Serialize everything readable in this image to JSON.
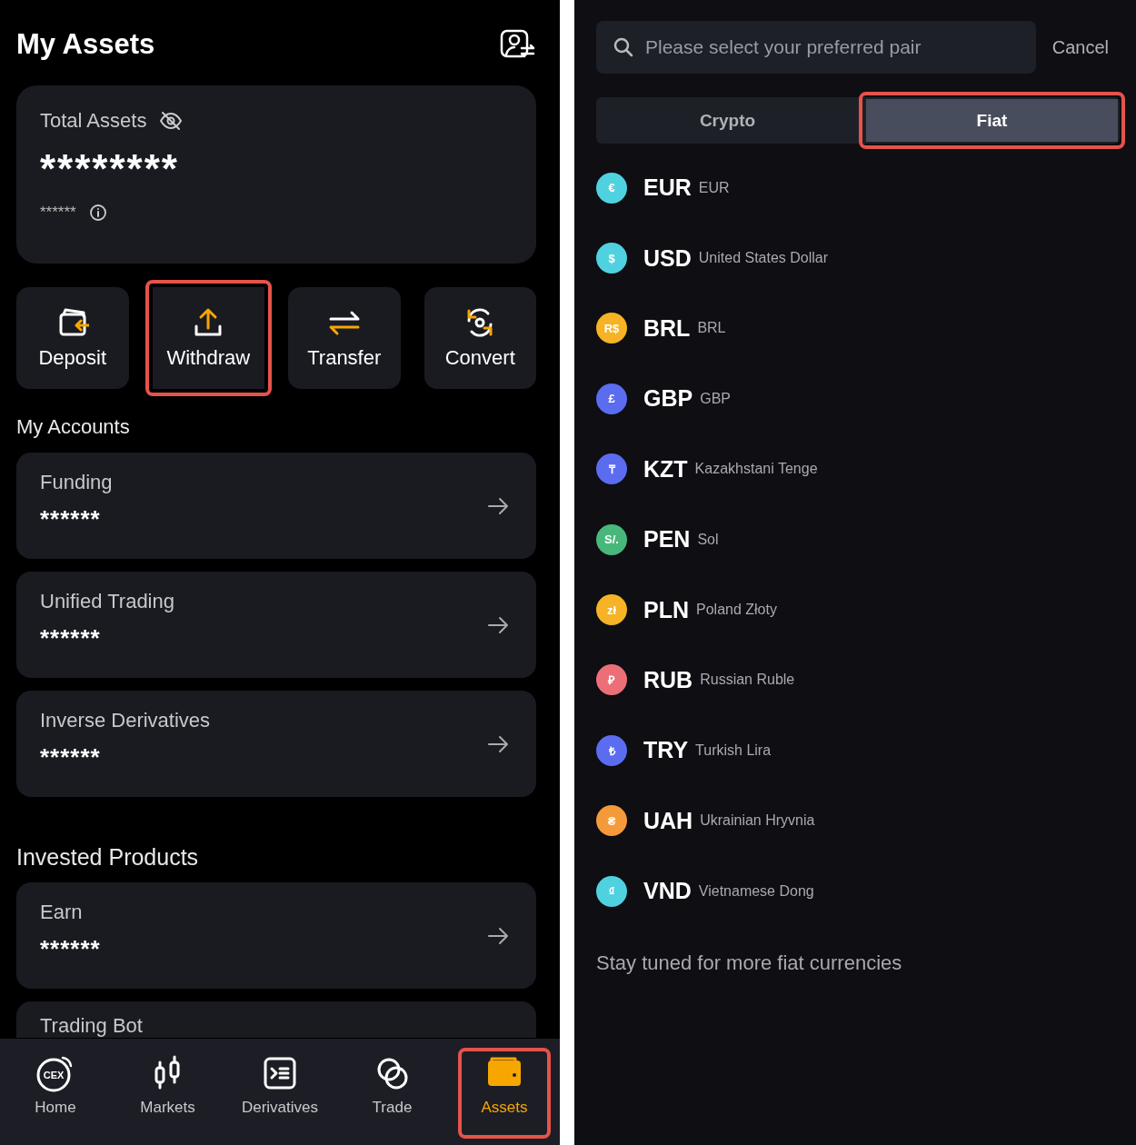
{
  "assets": {
    "title": "My Assets",
    "total": {
      "label": "Total Assets",
      "value": "********",
      "sub_value": "******"
    },
    "actions": [
      {
        "kind": "deposit",
        "label": "Deposit",
        "highlighted": false
      },
      {
        "kind": "withdraw",
        "label": "Withdraw",
        "highlighted": true
      },
      {
        "kind": "transfer",
        "label": "Transfer",
        "highlighted": false
      },
      {
        "kind": "convert",
        "label": "Convert",
        "highlighted": false
      }
    ],
    "accounts_heading": "My Accounts",
    "accounts": [
      {
        "name": "Funding",
        "value": "******"
      },
      {
        "name": "Unified Trading",
        "value": "******"
      },
      {
        "name": "Inverse Derivatives",
        "value": "******"
      }
    ],
    "invested_heading": "Invested Products",
    "invested": [
      {
        "name": "Earn",
        "value": "******"
      },
      {
        "name": "Trading Bot"
      }
    ],
    "nav": [
      {
        "kind": "home",
        "label": "Home",
        "logo_text": "CEX",
        "selected": false,
        "highlighted": false
      },
      {
        "kind": "markets",
        "label": "Markets",
        "selected": false,
        "highlighted": false
      },
      {
        "kind": "derivatives",
        "label": "Derivatives",
        "selected": false,
        "highlighted": false
      },
      {
        "kind": "trade",
        "label": "Trade",
        "selected": false,
        "highlighted": false
      },
      {
        "kind": "assets",
        "label": "Assets",
        "selected": true,
        "highlighted": true
      }
    ]
  },
  "picker": {
    "search": {
      "placeholder": "Please select your preferred pair"
    },
    "cancel": "Cancel",
    "tabs": [
      {
        "label": "Crypto",
        "selected": false,
        "highlighted": false
      },
      {
        "label": "Fiat",
        "selected": true,
        "highlighted": true
      }
    ],
    "currencies": [
      {
        "symbol": "€",
        "code": "EUR",
        "name": "EUR",
        "color": "#4fd1e0"
      },
      {
        "symbol": "$",
        "code": "USD",
        "name": "United States Dollar",
        "color": "#4fd1e0"
      },
      {
        "symbol": "R$",
        "code": "BRL",
        "name": "BRL",
        "color": "#f5b325"
      },
      {
        "symbol": "£",
        "code": "GBP",
        "name": "GBP",
        "color": "#5b6cf0"
      },
      {
        "symbol": "₸",
        "code": "KZT",
        "name": "Kazakhstani Tenge",
        "color": "#5b6cf0"
      },
      {
        "symbol": "S/.",
        "code": "PEN",
        "name": "Sol",
        "color": "#48b87a"
      },
      {
        "symbol": "zł",
        "code": "PLN",
        "name": "Poland Złoty",
        "color": "#f5b325"
      },
      {
        "symbol": "₽",
        "code": "RUB",
        "name": "Russian Ruble",
        "color": "#ec6f78"
      },
      {
        "symbol": "₺",
        "code": "TRY",
        "name": "Turkish Lira",
        "color": "#5b6cf0"
      },
      {
        "symbol": "₴",
        "code": "UAH",
        "name": "Ukrainian Hryvnia",
        "color": "#f49a3a"
      },
      {
        "symbol": "₫",
        "code": "VND",
        "name": "Vietnamese Dong",
        "color": "#4fd1e0"
      }
    ],
    "footer": "Stay tuned for more fiat currencies"
  }
}
